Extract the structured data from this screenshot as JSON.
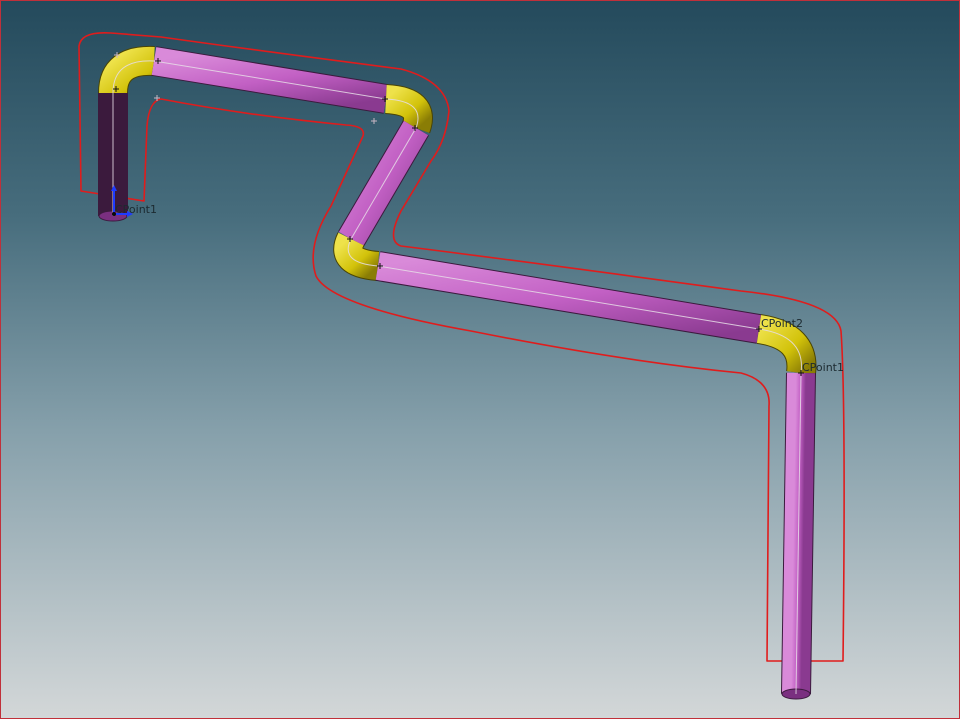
{
  "viewport": {
    "background_top": "#244a5c",
    "background_bottom": "#d3d7d8",
    "border_color": "#c0303a"
  },
  "route": {
    "pipe_color": "#c866c8",
    "elbow_color": "#d8c80a",
    "centerline_color": "#e8e0e8",
    "outline_sketch_color": "#e02020"
  },
  "labels": {
    "start_point": "CPoint1",
    "mid_point": "CPoint2",
    "end_point": "CPoint1"
  },
  "triad": {
    "icon": "coordinate-triad-icon",
    "x_color": "#1f3bff",
    "y_color": "#1f3bff"
  }
}
